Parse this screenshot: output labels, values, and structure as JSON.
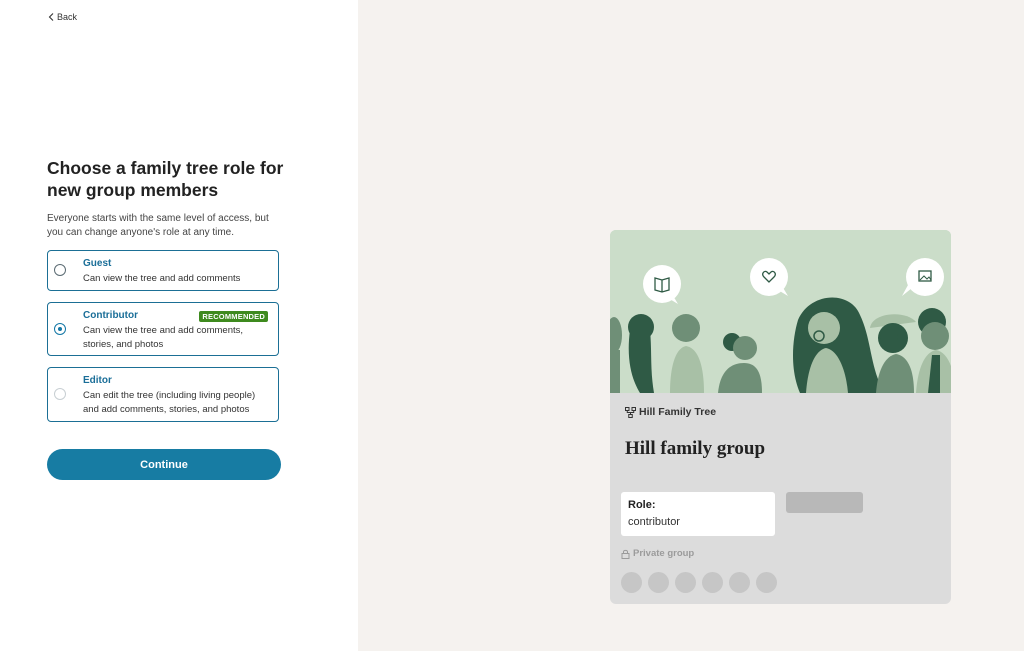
{
  "nav": {
    "back_label": "Back"
  },
  "heading": "Choose a family tree role for new group members",
  "subtitle": "Everyone starts with the same level of access, but you can change anyone's role at any time.",
  "options": [
    {
      "title": "Guest",
      "description": "Can view the tree and add comments",
      "selected": false
    },
    {
      "title": "Contributor",
      "description": "Can view the tree and add comments, stories, and photos",
      "badge": "RECOMMENDED",
      "selected": true
    },
    {
      "title": "Editor",
      "description": "Can edit the tree (including living people) and add comments, stories, and photos",
      "selected": false
    }
  ],
  "continue_label": "Continue",
  "preview": {
    "tree_name": "Hill Family Tree",
    "group_name": "Hill family group",
    "role_label": "Role:",
    "role_value": "contributor",
    "privacy_label": "Private group",
    "avatar_count": 6,
    "banner_icons": [
      "book-icon",
      "heart-icon",
      "photo-icon"
    ]
  },
  "colors": {
    "accent": "#177ca3",
    "option_title": "#1a6e98",
    "badge": "#3e8a1e",
    "banner_bg": "#cbddc9",
    "figure_dark": "#2f5a45",
    "figure_mid": "#6f8f77",
    "figure_light": "#a8c0a6",
    "right_panel_bg": "#f5f2ef"
  }
}
